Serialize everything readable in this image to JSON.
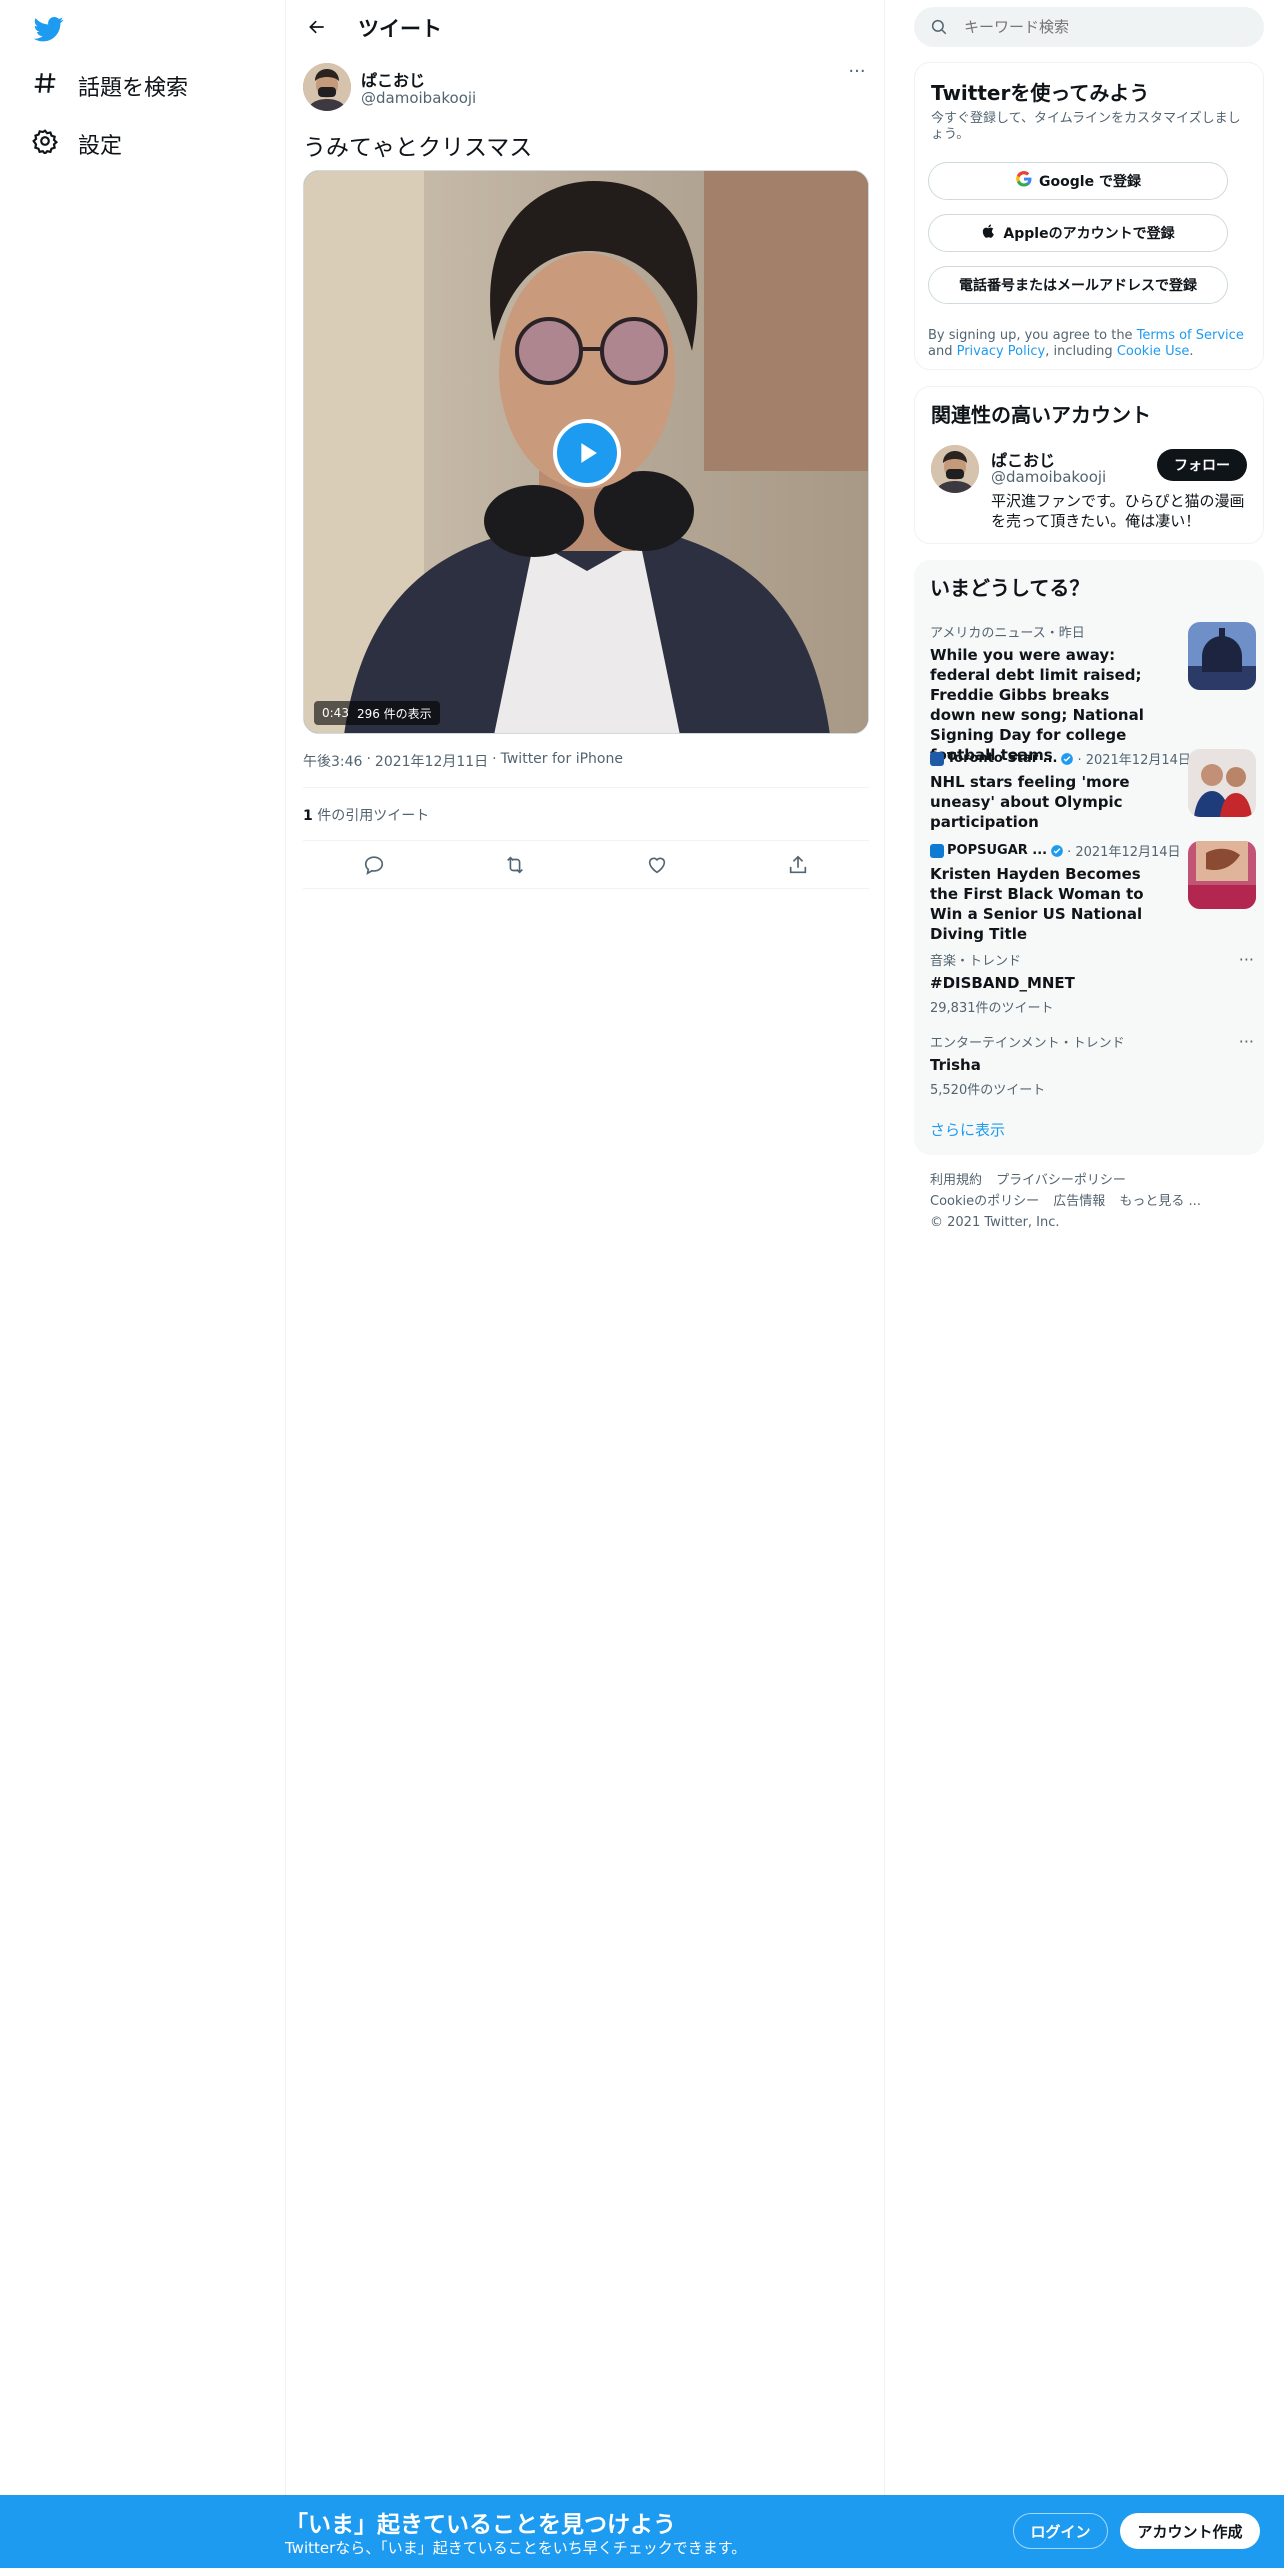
{
  "nav": {
    "logo_icon": "twitter-bird-icon",
    "explore_label": "話題を検索",
    "settings_label": "設定"
  },
  "header": {
    "title": "ツイート"
  },
  "tweet": {
    "author_name": "ぱこおじ",
    "author_handle": "@damoibakooji",
    "text": "うみてゃとクリスマス",
    "video_duration": "0:43",
    "video_views": "296 件の表示",
    "time": "午後3:46",
    "date": "2021年12月11日",
    "source": "Twitter for iPhone",
    "separator": "·",
    "quote_count": "1",
    "quote_label": "件の引用ツイート"
  },
  "search": {
    "placeholder": "キーワード検索"
  },
  "signup": {
    "title": "Twitterを使ってみよう",
    "subtitle": "今すぐ登録して、タイムラインをカスタマイズしましょう。",
    "google_label": "Google で登録",
    "apple_label": "Appleのアカウントで登録",
    "phone_label": "電話番号またはメールアドレスで登録",
    "terms_prefix": "By signing up, you agree to the ",
    "terms_link": "Terms of Service",
    "terms_and": " and ",
    "privacy_link": "Privacy Policy",
    "terms_including": ", including ",
    "cookie_link": "Cookie Use",
    "terms_end": "."
  },
  "related": {
    "title": "関連性の高いアカウント",
    "name": "ぱこおじ",
    "handle": "@damoibakooji",
    "bio": "平沢進ファンです。ひらぴと猫の漫画を売って頂きたい。俺は凄い！",
    "follow_label": "フォロー"
  },
  "trends": {
    "title": "いまどうしてる？",
    "items": [
      {
        "context": "アメリカのニュース・昨日",
        "title": "While you were away: federal debt limit raised; Freddie Gibbs breaks down new song; National Signing Day for college football teams"
      },
      {
        "source": "Toronto Star ...",
        "date": "· 2021年12月14日",
        "title": "NHL stars feeling 'more uneasy' about Olympic participation"
      },
      {
        "source": "POPSUGAR ...",
        "date": "· 2021年12月14日",
        "title": "Kristen Hayden Becomes the First Black Woman to Win a Senior US National Diving Title"
      },
      {
        "context": "音楽・トレンド",
        "title": "#DISBAND_MNET",
        "count": "29,831件のツイート"
      },
      {
        "context": "エンターテインメント・トレンド",
        "title": "Trisha",
        "count": "5,520件のツイート"
      }
    ],
    "show_more": "さらに表示"
  },
  "footer": {
    "terms": "利用規約",
    "privacy": "プライバシーポリシー",
    "cookie": "Cookieのポリシー",
    "ads": "広告情報",
    "more": "もっと見る ...",
    "copyright": "© 2021 Twitter, Inc."
  },
  "banner": {
    "title": "「いま」起きていることを見つけよう",
    "subtitle": "Twitterなら、「いま」起きていることをいち早くチェックできます。",
    "login": "ログイン",
    "create": "アカウント作成"
  },
  "colors": {
    "accent": "#1d9bf0",
    "text": "#0f1419",
    "muted": "#536471"
  }
}
